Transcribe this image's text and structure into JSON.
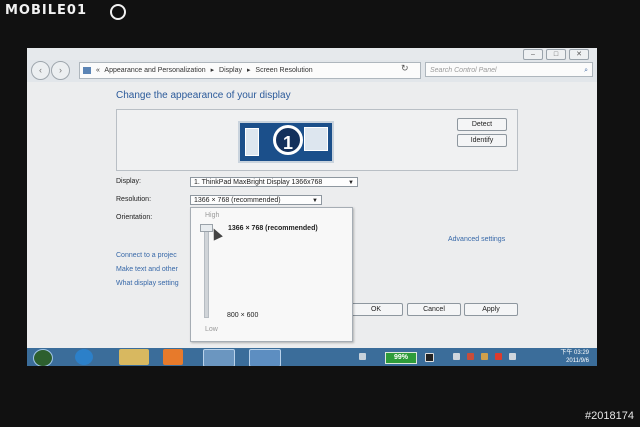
{
  "photo": {
    "brand": "MOBILE01",
    "id": "#2018174"
  },
  "window": {
    "controls": [
      "–",
      "□",
      "✕"
    ]
  },
  "nav": {
    "back": "‹",
    "forward": "›",
    "breadcrumb": [
      "«",
      "Appearance and Personalization",
      "▸",
      "Display",
      "▸",
      "Screen Resolution"
    ],
    "refresh": "↻",
    "search_placeholder": "Search Control Panel",
    "search_icon": "search-icon"
  },
  "page": {
    "title": "Change the appearance of your display",
    "monitor_number": "1",
    "detect_label": "Detect",
    "identify_label": "Identify",
    "display_label": "Display:",
    "display_value": "1. ThinkPad MaxBright Display 1366x768",
    "resolution_label": "Resolution:",
    "resolution_value": "1366 × 768 (recommended)",
    "orientation_label": "Orientation:",
    "advanced_link": "Advanced settings",
    "links": [
      "Connect to a projec",
      "Make text and other",
      "What display setting"
    ],
    "ok_label": "OK",
    "cancel_label": "Cancel",
    "apply_label": "Apply"
  },
  "resolution_popup": {
    "high_label": "High",
    "low_label": "Low",
    "selected": "1366 × 768 (recommended)",
    "min_option": "800 × 600",
    "slider_level": 1.0
  },
  "taskbar": {
    "battery": "99%",
    "time": "下午 03:29",
    "date": "2011/9/6"
  },
  "colors": {
    "accent": "#2b5a9a",
    "link": "#3768a8",
    "taskbar": "#3b6d9a",
    "battery": "#2e9c3a"
  }
}
